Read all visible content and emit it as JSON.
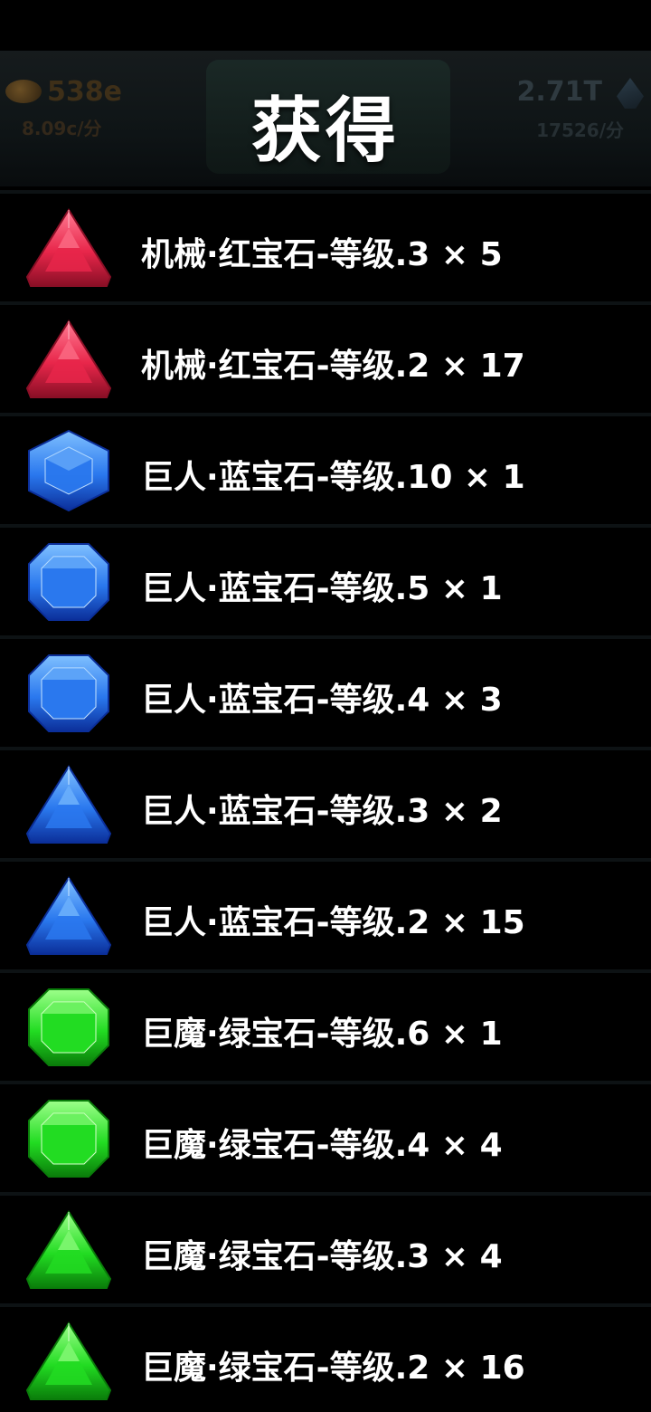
{
  "title": "获得",
  "background_header": {
    "coin_value": "538e",
    "coin_rate": "8.09c/分",
    "gem_value": "2.71T",
    "gem_rate": "17526/分"
  },
  "colors": {
    "red": "#e8264a",
    "blue": "#2a78ee",
    "green": "#22dc22",
    "text": "#ffffff",
    "background": "#000000"
  },
  "rewards": [
    {
      "label": "机械·红宝石-等级.3 × 5",
      "gem": "red",
      "shape": "triangle",
      "icon": "red-triangle-gem-icon"
    },
    {
      "label": "机械·红宝石-等级.2 × 17",
      "gem": "red",
      "shape": "triangle",
      "icon": "red-triangle-gem-icon"
    },
    {
      "label": "巨人·蓝宝石-等级.10 × 1",
      "gem": "blue",
      "shape": "hexagon",
      "icon": "blue-hexagon-gem-icon"
    },
    {
      "label": "巨人·蓝宝石-等级.5 × 1",
      "gem": "blue",
      "shape": "octagon",
      "icon": "blue-octagon-gem-icon"
    },
    {
      "label": "巨人·蓝宝石-等级.4 × 3",
      "gem": "blue",
      "shape": "octagon",
      "icon": "blue-octagon-gem-icon"
    },
    {
      "label": "巨人·蓝宝石-等级.3 × 2",
      "gem": "blue",
      "shape": "triangle",
      "icon": "blue-triangle-gem-icon"
    },
    {
      "label": "巨人·蓝宝石-等级.2 × 15",
      "gem": "blue",
      "shape": "triangle",
      "icon": "blue-triangle-gem-icon"
    },
    {
      "label": "巨魔·绿宝石-等级.6 × 1",
      "gem": "green",
      "shape": "octagon",
      "icon": "green-octagon-gem-icon"
    },
    {
      "label": "巨魔·绿宝石-等级.4 × 4",
      "gem": "green",
      "shape": "octagon",
      "icon": "green-octagon-gem-icon"
    },
    {
      "label": "巨魔·绿宝石-等级.3 × 4",
      "gem": "green",
      "shape": "triangle",
      "icon": "green-triangle-gem-icon"
    },
    {
      "label": "巨魔·绿宝石-等级.2 × 16",
      "gem": "green",
      "shape": "triangle",
      "icon": "green-triangle-gem-icon"
    }
  ]
}
